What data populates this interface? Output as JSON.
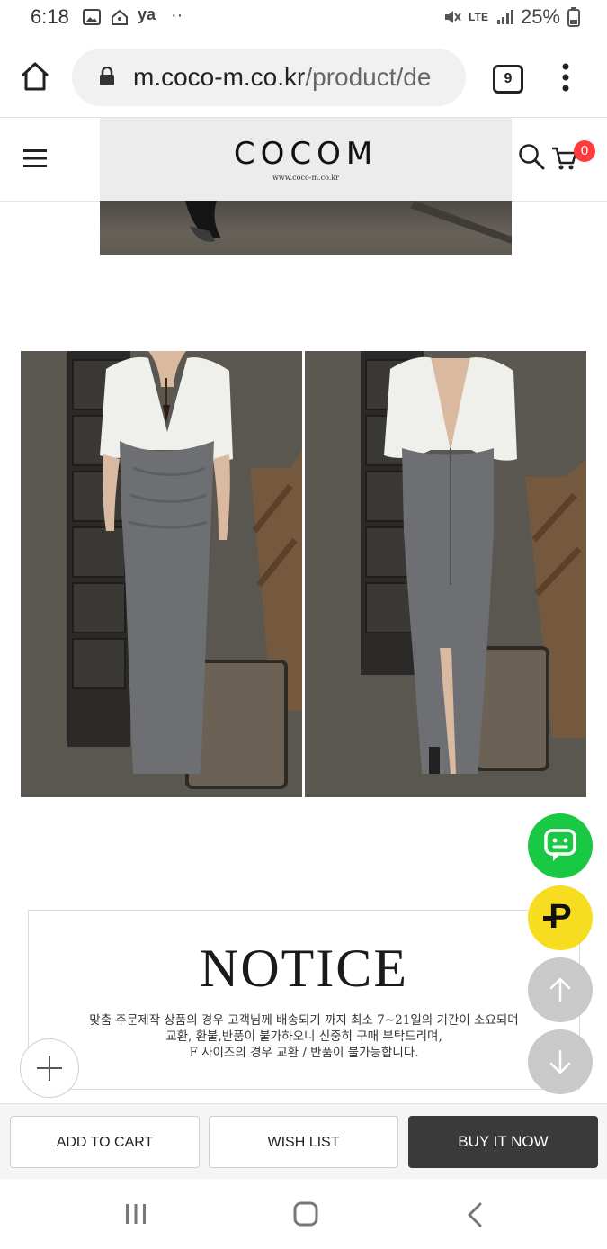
{
  "status_bar": {
    "time": "6:18",
    "carrier": "ya",
    "dots": "··",
    "network": "LTE",
    "battery": "25%"
  },
  "browser": {
    "url_domain": "m.coco-m.co.kr",
    "url_path": "/product/de",
    "tab_count": "9"
  },
  "site_header": {
    "logo": "COCOM",
    "logo_sub": "www.coco-m.co.kr",
    "cart_count": "0"
  },
  "notice": {
    "title": "NOTICE",
    "lines": [
      "맞춤 주문제작 상품의 경우 고객님께 배송되기 까지 최소 7~21일의 기간이 소요되며",
      "교환, 환불,반품이 불가하오니 신중히 구매 부탁드리며,",
      "F 사이즈의 경우 교환 / 반품이 불가능합니다."
    ]
  },
  "floating": {
    "point_label": "P"
  },
  "actions": {
    "add_to_cart": "ADD TO CART",
    "wish_list": "WISH LIST",
    "buy_now": "BUY IT NOW"
  },
  "colors": {
    "chat_green": "#19c843",
    "point_yellow": "#f6dd1f",
    "cart_badge": "#ff3b3b",
    "buy_button": "#3a3a3a"
  }
}
